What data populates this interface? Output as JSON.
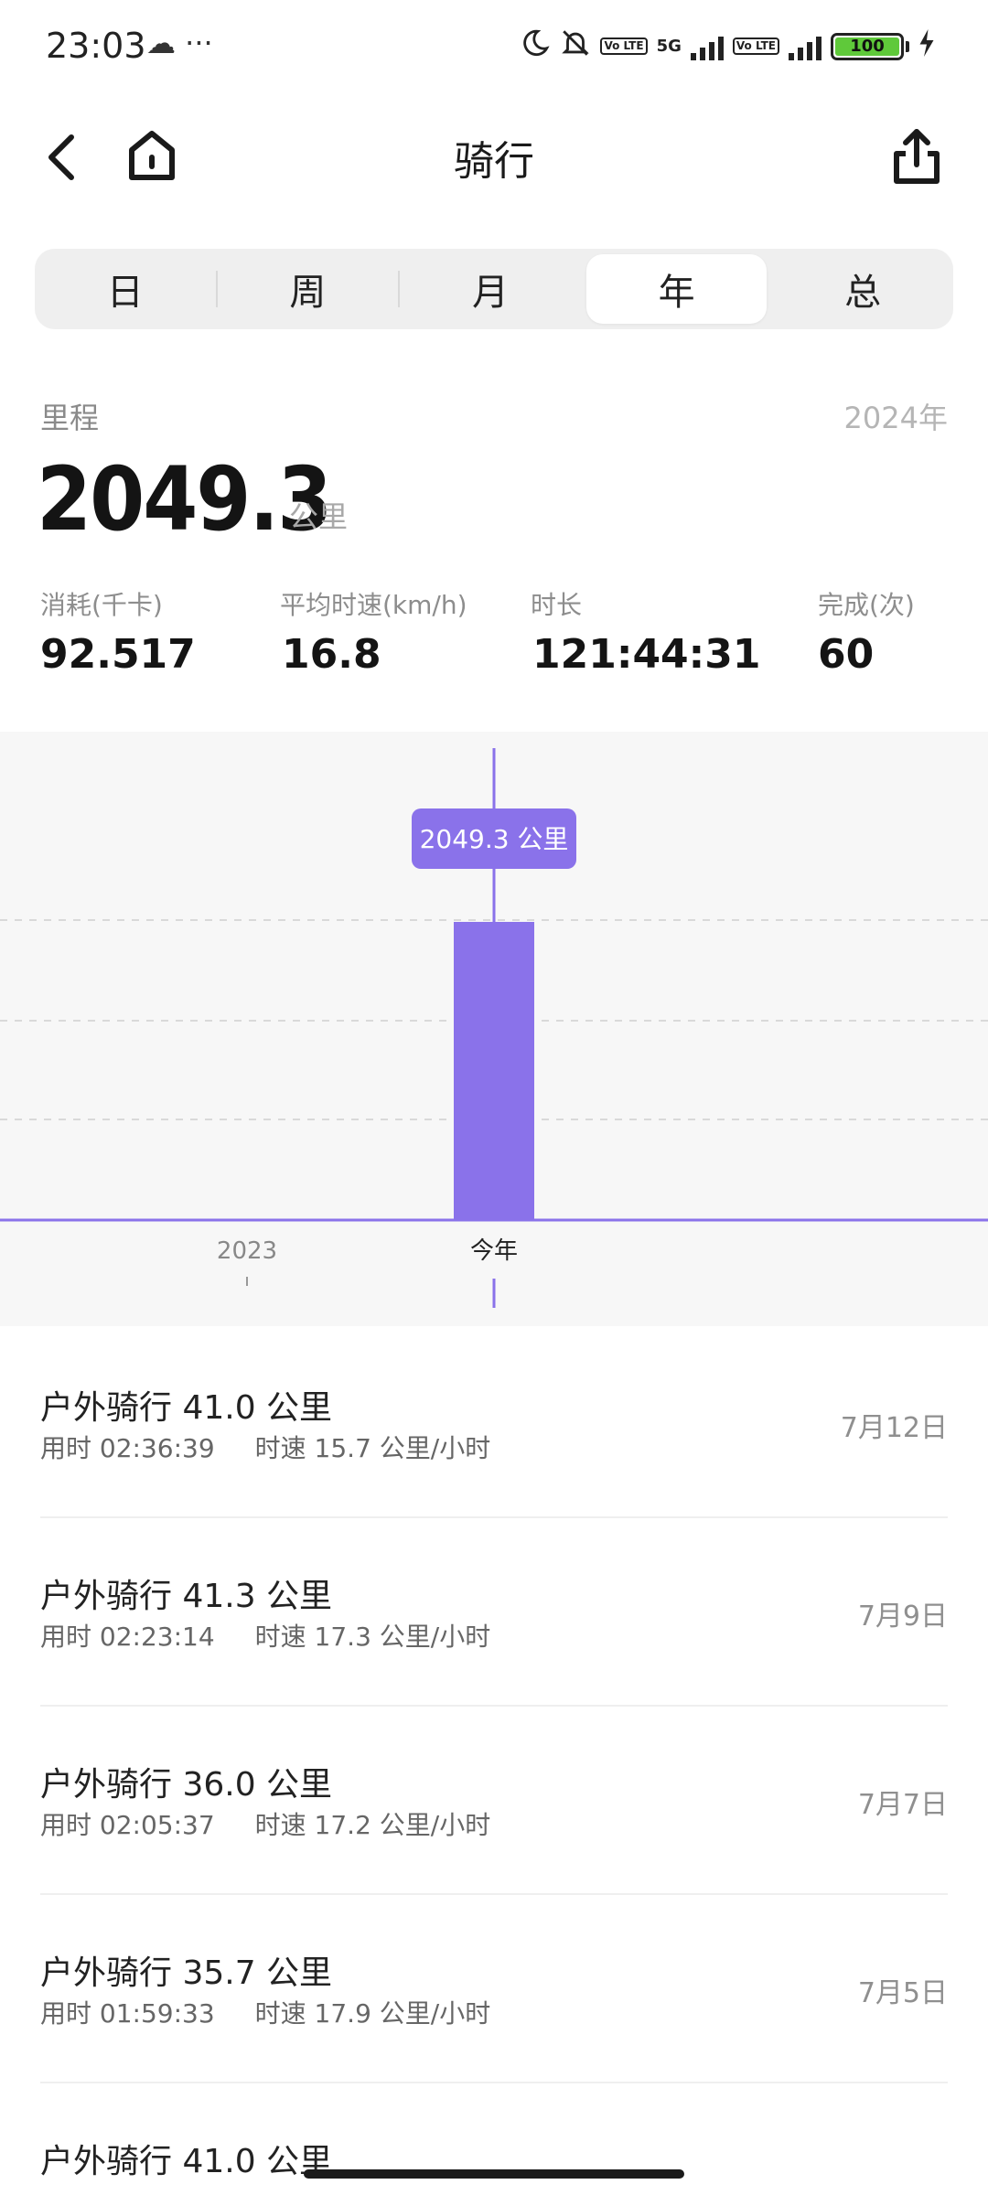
{
  "status_bar": {
    "time": "23:03",
    "left_icons": "☁ ···",
    "network_5g": "5G",
    "volte_1": "Vo\nLTE",
    "volte_2": "Vo\nLTE",
    "battery": "100"
  },
  "header": {
    "title": "骑行",
    "back_icon": "chevron-left-icon",
    "home_icon": "home-icon",
    "share_icon": "share-icon"
  },
  "tabs": [
    {
      "label": "日",
      "active": false
    },
    {
      "label": "周",
      "active": false
    },
    {
      "label": "月",
      "active": false
    },
    {
      "label": "年",
      "active": true
    },
    {
      "label": "总",
      "active": false
    }
  ],
  "summary": {
    "distance_label": "里程",
    "year": "2024年",
    "distance_value": "2049.3",
    "distance_unit": "公里",
    "stats": [
      {
        "label": "消耗(千卡)",
        "value": "92.517"
      },
      {
        "label": "平均时速(km/h)",
        "value": "16.8"
      },
      {
        "label": "时长",
        "value": "121:44:31"
      },
      {
        "label": "完成(次)",
        "value": "60"
      }
    ]
  },
  "chart_data": {
    "type": "bar",
    "categories": [
      "2023",
      "今年"
    ],
    "values": [
      0,
      2049.3
    ],
    "tooltip": "2049.3 公里",
    "selected_index": 1,
    "bar_color": "#8a72ea",
    "grid": true
  },
  "activities": [
    {
      "title": "户外骑行 41.0 公里",
      "duration": "用时 02:36:39",
      "speed": "时速 15.7 公里/小时",
      "date": "7月12日"
    },
    {
      "title": "户外骑行 41.3 公里",
      "duration": "用时 02:23:14",
      "speed": "时速 17.3 公里/小时",
      "date": "7月9日"
    },
    {
      "title": "户外骑行 36.0 公里",
      "duration": "用时 02:05:37",
      "speed": "时速 17.2 公里/小时",
      "date": "7月7日"
    },
    {
      "title": "户外骑行 35.7 公里",
      "duration": "用时 01:59:33",
      "speed": "时速 17.9 公里/小时",
      "date": "7月5日"
    },
    {
      "title": "户外骑行 41.0 公里",
      "duration": "",
      "speed": "",
      "date": ""
    }
  ]
}
